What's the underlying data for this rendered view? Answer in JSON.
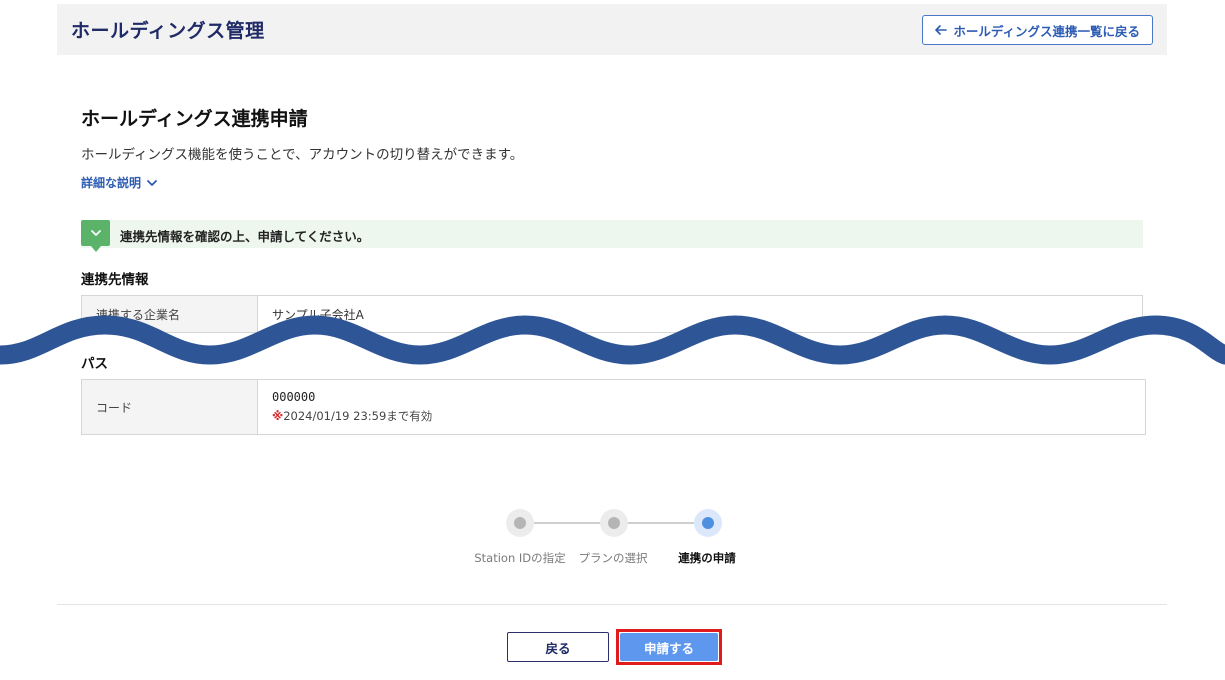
{
  "header": {
    "title": "ホールディングス管理",
    "back_link_label": "ホールディングス連携一覧に戻る"
  },
  "page": {
    "title": "ホールディングス連携申請",
    "description": "ホールディングス機能を使うことで、アカウントの切り替えができます。",
    "detail_link": "詳細な説明"
  },
  "notice": {
    "text": "連携先情報を確認の上、申請してください。"
  },
  "partner_section": {
    "title": "連携先情報",
    "rows": [
      {
        "label": "連携する企業名",
        "value": "サンプル子会社A"
      }
    ]
  },
  "passcode_section": {
    "title": "パス",
    "rows": [
      {
        "label": "コード",
        "value": "000000",
        "expire_mark": "※",
        "expire_text": "2024/01/19 23:59まで有効"
      }
    ]
  },
  "stepper": {
    "steps": [
      {
        "label": "Station IDの指定",
        "state": "done"
      },
      {
        "label": "プランの選択",
        "state": "done"
      },
      {
        "label": "連携の申請",
        "state": "active"
      }
    ]
  },
  "actions": {
    "back_label": "戻る",
    "submit_label": "申請する"
  },
  "colors": {
    "header_title": "#1f2a66",
    "link": "#2d5cb3",
    "notice_icon": "#5bb36a",
    "active_step": "#4f8fe0",
    "submit_button": "#5d97ee",
    "highlight_frame": "#e01b1b",
    "wave_overlay": "#2e5596"
  },
  "icons": {
    "back_link": "arrow-left-icon",
    "detail_link": "chevron-down-icon",
    "notice": "chevron-down-icon"
  }
}
